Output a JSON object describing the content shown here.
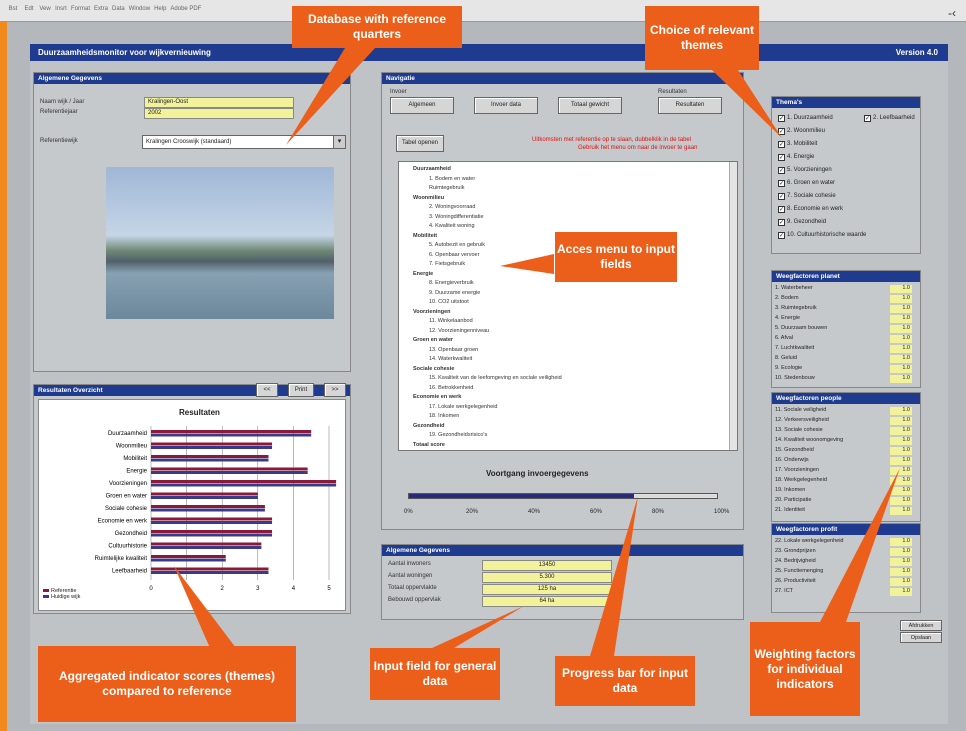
{
  "toolbar": {
    "menu": [
      "Bst",
      "Edt",
      "Vew",
      "Insrt",
      "Format",
      "Extra",
      "Data",
      "Window",
      "Help",
      "Adobe PDF"
    ],
    "row2": [
      "▾",
      "▾"
    ]
  },
  "app": {
    "title": "Duurzaamheidsmonitor voor wijkvernieuwing",
    "version": "Version 4.0"
  },
  "general": {
    "head": "Algemene Gegevens",
    "name_label": "Naam wijk / Jaar",
    "name_value": "Kralingen-Oost",
    "refyear_label": "Referentiejaar",
    "refyear_value": "2002",
    "ref_label": "Referentiewijk",
    "ref_value": "Kralingen Crooswijk (standaard)"
  },
  "nav": {
    "head": "Navigatie",
    "group1": "Invoer",
    "group2": "Resultaten",
    "btn1": "Algemeen",
    "btn2": "Invoer data",
    "btn3": "Totaal gewicht",
    "btn4": "Resultaten",
    "btn_tree": "Tabel openen",
    "hint1": "Uitkomsten met referentie op te slaan, dubbelklik in de tabel",
    "hint2": "Gebruik het menu om naar de invoer te gaan"
  },
  "tree": {
    "items": [
      {
        "t": "Duurzaamheid",
        "l": 1
      },
      {
        "t": "1. Bodem en water",
        "l": 2
      },
      {
        "t": "Ruimtegebruik",
        "l": 2
      },
      {
        "t": "Woonmilieu",
        "l": 1
      },
      {
        "t": "2. Woningvoorraad",
        "l": 2
      },
      {
        "t": "3. Woningdifferentiatie",
        "l": 2
      },
      {
        "t": "4. Kwaliteit woning",
        "l": 2
      },
      {
        "t": "Mobiliteit",
        "l": 1
      },
      {
        "t": "5. Autobezit en gebruik",
        "l": 2
      },
      {
        "t": "6. Openbaar vervoer",
        "l": 2
      },
      {
        "t": "7. Fietsgebruik",
        "l": 2
      },
      {
        "t": "Energie",
        "l": 1
      },
      {
        "t": "8. Energieverbruik",
        "l": 2
      },
      {
        "t": "9. Duurzame energie",
        "l": 2
      },
      {
        "t": "10. CO2 uitstoot",
        "l": 2
      },
      {
        "t": "Voorzieningen",
        "l": 1
      },
      {
        "t": "11. Winkelaanbod",
        "l": 2
      },
      {
        "t": "12. Voorzieningenniveau",
        "l": 2
      },
      {
        "t": "Groen en water",
        "l": 1
      },
      {
        "t": "13. Openbaar groen",
        "l": 2
      },
      {
        "t": "14. Waterkwaliteit",
        "l": 2
      },
      {
        "t": "Sociale cohesie",
        "l": 1
      },
      {
        "t": "15. Kwaliteit van de leefomgeving en sociale veiligheid",
        "l": 2
      },
      {
        "t": "16. Betrokkenheid",
        "l": 2
      },
      {
        "t": "Economie en werk",
        "l": 1
      },
      {
        "t": "17. Lokale werkgelegenheid",
        "l": 2
      },
      {
        "t": "18. Inkomen",
        "l": 2
      },
      {
        "t": "Gezondheid",
        "l": 1
      },
      {
        "t": "19. Gezondheidsrisico's",
        "l": 2
      },
      {
        "t": "Totaal score",
        "l": 1
      }
    ]
  },
  "progress": {
    "label": "Voortgang invoergegevens",
    "ticks": [
      "0%",
      "20%",
      "40%",
      "60%",
      "80%",
      "100%"
    ],
    "value": 0.73
  },
  "themes": {
    "head": "Thema's",
    "items": [
      {
        "t": "1. Duurzaamheid",
        "c": true
      },
      {
        "t": "2. Woonmilieu",
        "c": true
      },
      {
        "t": "3. Mobiliteit",
        "c": true
      },
      {
        "t": "4. Energie",
        "c": true
      },
      {
        "t": "5. Voorzieningen",
        "c": true
      },
      {
        "t": "6. Groen en water",
        "c": true
      },
      {
        "t": "7. Sociale cohesie",
        "c": true
      },
      {
        "t": "8. Economie en werk",
        "c": true
      },
      {
        "t": "9. Gezondheid",
        "c": true
      },
      {
        "t": "10. Cultuurhistorische waarde",
        "c": true
      }
    ],
    "extra": "2. Leefbaarheid"
  },
  "weights1": {
    "head": "Weegfactoren planet",
    "rows": [
      "1. Waterbeheer",
      "2. Bodem",
      "3. Ruimtegebruik",
      "4. Energie",
      "5. Duurzaam bouwen",
      "6. Afval",
      "7. Luchtkwaliteit",
      "8. Geluid",
      "9. Ecologie",
      "10. Stedenbouw"
    ],
    "vals": [
      "1.0",
      "1.0",
      "1.0",
      "1.0",
      "1.0",
      "1.0",
      "1.0",
      "1.0",
      "1.0",
      "1.0"
    ]
  },
  "weights2": {
    "head": "Weegfactoren people",
    "rows": [
      "11. Sociale veiligheid",
      "12. Verkeersveiligheid",
      "13. Sociale cohesie",
      "14. Kwaliteit woonomgeving",
      "15. Gezondheid",
      "16. Onderwijs",
      "17. Voorzieningen",
      "18. Werkgelegenheid",
      "19. Inkomen",
      "20. Participatie",
      "21. Identiteit"
    ],
    "vals": [
      "1.0",
      "1.0",
      "1.0",
      "1.0",
      "1.0",
      "1.0",
      "1.0",
      "1.0",
      "1.0",
      "1.0",
      "1.0"
    ]
  },
  "weights3": {
    "head": "Weegfactoren profit",
    "rows": [
      "22. Lokale werkgelegenheid",
      "23. Grondprijzen",
      "24. Bedrijvigheid",
      "25. Functiemenging",
      "26. Productiviteit",
      "27. ICT"
    ],
    "vals": [
      "1.0",
      "1.0",
      "1.0",
      "1.0",
      "1.0",
      "1.0"
    ]
  },
  "results": {
    "head": "Resultaten Overzicht",
    "btns": [
      "<<",
      "Print",
      ">>"
    ],
    "chart_title": "Resultaten",
    "legend": [
      "Referentie",
      "Huidige wijk"
    ]
  },
  "chart_data": {
    "type": "bar",
    "title": "Resultaten",
    "categories": [
      "Duurzaamheid",
      "Woonmilieu",
      "Mobiliteit",
      "Energie",
      "Voorzieningen",
      "Groen en water",
      "Sociale cohesie",
      "Economie en werk",
      "Gezondheid",
      "Cultuurhistorie",
      "Ruimtelijke kwaliteit",
      "Leefbaarheid"
    ],
    "series": [
      {
        "name": "Referentie",
        "values": [
          4.5,
          3.4,
          3.3,
          4.4,
          5.2,
          3.0,
          3.2,
          3.4,
          3.4,
          3.1,
          2.1,
          3.3
        ]
      },
      {
        "name": "Huidige wijk",
        "values": [
          4.5,
          3.4,
          3.3,
          4.4,
          5.2,
          3.0,
          3.2,
          3.4,
          3.4,
          3.1,
          2.1,
          3.3
        ]
      }
    ],
    "xlim": [
      0,
      5
    ],
    "xticks": [
      "0",
      "1",
      "2",
      "3",
      "4",
      "5"
    ]
  },
  "gen_data": {
    "head": "Algemene Gegevens",
    "rows": [
      {
        "l": "Aantal inwoners",
        "v": "13450"
      },
      {
        "l": "Aantal woningen",
        "v": "5.300"
      },
      {
        "l": "Totaal oppervlakte",
        "v": "125 ha"
      },
      {
        "l": "Bebouwd oppervlak",
        "v": "64 ha"
      }
    ]
  },
  "side_btns": [
    "Afdrukken",
    "Opslaan"
  ],
  "callouts": {
    "c1": "Database with reference quarters",
    "c2": "Choice of relevant themes",
    "c3": "Acces menu to input fields",
    "c4": "Weighting factors for individual indicators",
    "c5": "Aggregated indicator scores (themes) compared to reference",
    "c6": "Input field for general data",
    "c7": "Progress bar for input data"
  }
}
